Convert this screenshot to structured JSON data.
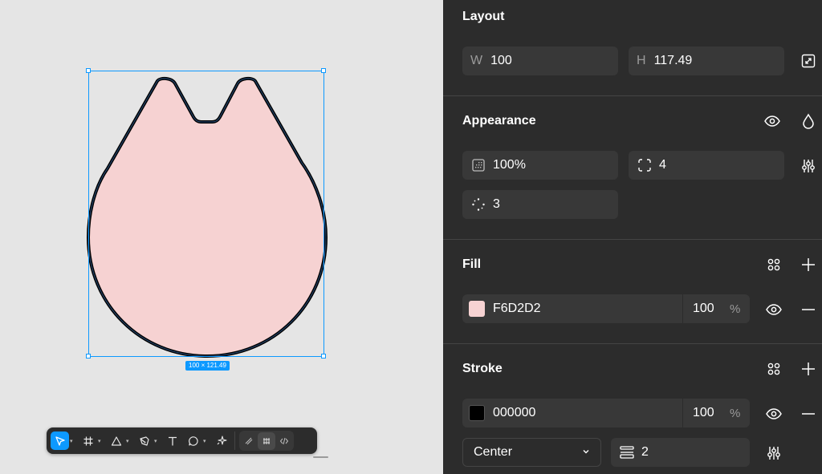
{
  "canvas": {
    "size_label": "100 × 121.49",
    "shape_fill": "#F6D2D2",
    "shape_stroke": "#000000",
    "selection_color": "#0d99ff"
  },
  "toolbar": {
    "tools": [
      {
        "name": "move-tool",
        "icon": "cursor-icon",
        "active": true,
        "has_caret": true
      },
      {
        "name": "frame-tool",
        "icon": "frame-hash-icon",
        "has_caret": true
      },
      {
        "name": "shape-tool",
        "icon": "triangle-icon",
        "has_caret": true
      },
      {
        "name": "pen-tool",
        "icon": "pen-nib-icon",
        "has_caret": true
      },
      {
        "name": "text-tool",
        "icon": "text-t-icon",
        "has_caret": false
      },
      {
        "name": "comment-tool",
        "icon": "comment-bubble-icon",
        "has_caret": true
      },
      {
        "name": "actions-tool",
        "icon": "sparkle-icon",
        "has_caret": false
      }
    ],
    "modes": [
      "draw-mode-icon",
      "design-mode-icon",
      "dev-mode-icon"
    ]
  },
  "layout": {
    "title": "Layout",
    "w_label": "W",
    "w_value": "100",
    "h_label": "H",
    "h_value": "117.49"
  },
  "appearance": {
    "title": "Appearance",
    "opacity": "100%",
    "corner_radius": "4",
    "corner_smoothing": "3"
  },
  "fill": {
    "title": "Fill",
    "color_hex": "F6D2D2",
    "swatch": "#F6D2D2",
    "opacity": "100",
    "pct": "%"
  },
  "stroke": {
    "title": "Stroke",
    "color_hex": "000000",
    "swatch": "#000000",
    "opacity": "100",
    "pct": "%",
    "position": "Center",
    "weight": "2"
  }
}
